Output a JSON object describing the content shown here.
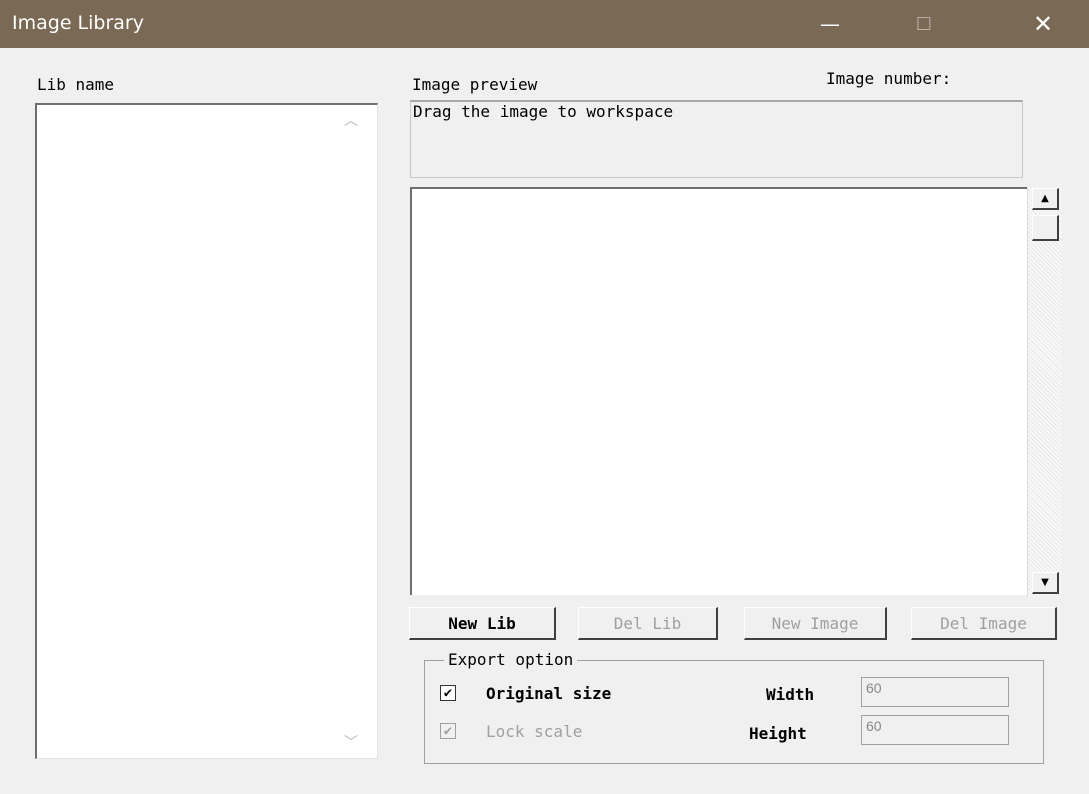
{
  "window": {
    "title": "Image Library",
    "minimize": "—",
    "maximize": "☐",
    "close": "✕"
  },
  "lib": {
    "label": "Lib name",
    "scroll_up": "︿",
    "scroll_down": "﹀"
  },
  "preview": {
    "label": "Image preview",
    "image_number_label": "Image number:",
    "hint": "Drag the image to workspace",
    "scroll_up": "▲",
    "scroll_down": "▼"
  },
  "buttons": {
    "new_lib": "New Lib",
    "del_lib": "Del Lib",
    "new_image": "New Image",
    "del_image": "Del Image"
  },
  "export": {
    "group_label": "Export option",
    "original_size": {
      "label": "Original size",
      "checked": true
    },
    "lock_scale": {
      "label": "Lock scale",
      "checked": true,
      "enabled": false
    },
    "width_label": "Width",
    "width_value": "60",
    "height_label": "Height",
    "height_value": "60",
    "check_glyph": "✔"
  }
}
